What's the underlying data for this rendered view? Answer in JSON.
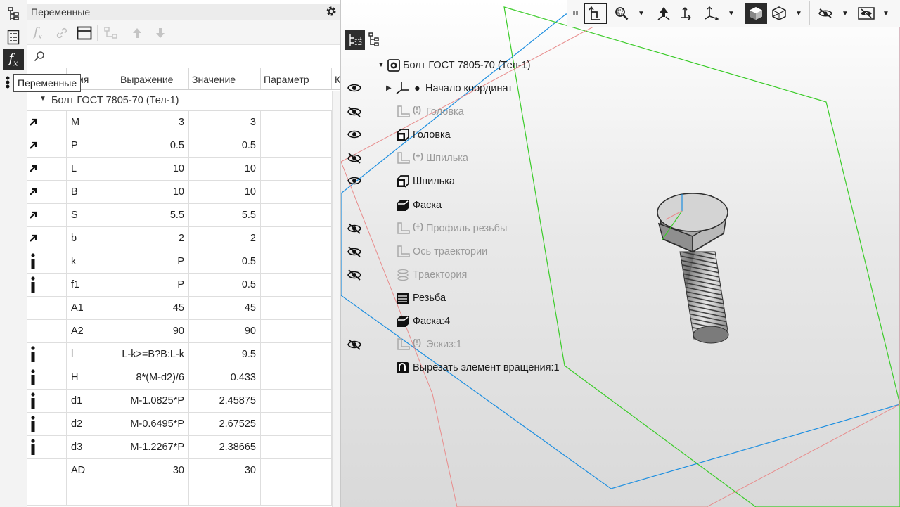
{
  "panel": {
    "title": "Переменные",
    "search_placeholder": "",
    "columns": [
      "Имя",
      "Выражение",
      "Значение",
      "Параметр",
      "К"
    ],
    "group_label": "Болт ГОСТ 7805-70 (Тел-1)",
    "rows": [
      {
        "icon": "arrow",
        "name": "M",
        "expr": "3",
        "value": "3"
      },
      {
        "icon": "arrow",
        "name": "P",
        "expr": "0.5",
        "value": "0.5"
      },
      {
        "icon": "arrow",
        "name": "L",
        "expr": "10",
        "value": "10"
      },
      {
        "icon": "arrow",
        "name": "B",
        "expr": "10",
        "value": "10"
      },
      {
        "icon": "arrow",
        "name": "S",
        "expr": "5.5",
        "value": "5.5"
      },
      {
        "icon": "arrow",
        "name": "b",
        "expr": "2",
        "value": "2"
      },
      {
        "icon": "info",
        "name": "k",
        "expr": "P",
        "value": "0.5"
      },
      {
        "icon": "info",
        "name": "f1",
        "expr": "P",
        "value": "0.5"
      },
      {
        "icon": "",
        "name": "A1",
        "expr": "45",
        "value": "45"
      },
      {
        "icon": "",
        "name": "A2",
        "expr": "90",
        "value": "90"
      },
      {
        "icon": "info",
        "name": "l",
        "expr": "L-k>=B?B:L-k",
        "value": "9.5"
      },
      {
        "icon": "info",
        "name": "H",
        "expr": "8*(M-d2)/6",
        "value": "0.433"
      },
      {
        "icon": "info",
        "name": "d1",
        "expr": "M-1.0825*P",
        "value": "2.45875"
      },
      {
        "icon": "info",
        "name": "d2",
        "expr": "M-0.6495*P",
        "value": "2.67525"
      },
      {
        "icon": "info",
        "name": "d3",
        "expr": "M-1.2267*P",
        "value": "2.38665"
      },
      {
        "icon": "",
        "name": "AD",
        "expr": "30",
        "value": "30"
      },
      {
        "icon": "",
        "name": "",
        "expr": "",
        "value": ""
      }
    ]
  },
  "tooltip": {
    "text": "Переменные"
  },
  "tree": {
    "root": "Болт ГОСТ 7805-70 (Тел-1)",
    "items": [
      {
        "label": "Начало координат",
        "prefix": "",
        "eye": "visible",
        "dim": false,
        "kind": "origin"
      },
      {
        "label": "Головка",
        "prefix": "(!)",
        "eye": "hidden",
        "dim": true,
        "kind": "sketch"
      },
      {
        "label": "Головка",
        "prefix": "",
        "eye": "visible",
        "dim": false,
        "kind": "extrude"
      },
      {
        "label": "Шпилька",
        "prefix": "(+)",
        "eye": "hidden",
        "dim": true,
        "kind": "sketch"
      },
      {
        "label": "Шпилька",
        "prefix": "",
        "eye": "visible",
        "dim": false,
        "kind": "extrude"
      },
      {
        "label": "Фаска",
        "prefix": "",
        "eye": "",
        "dim": false,
        "kind": "chamfer"
      },
      {
        "label": "Профиль резьбы",
        "prefix": "(+)",
        "eye": "hidden",
        "dim": true,
        "kind": "sketch"
      },
      {
        "label": "Ось траектории",
        "prefix": "",
        "eye": "hidden",
        "dim": true,
        "kind": "sketch"
      },
      {
        "label": "Траектория",
        "prefix": "",
        "eye": "hidden",
        "dim": true,
        "kind": "spiral"
      },
      {
        "label": "Резьба",
        "prefix": "",
        "eye": "",
        "dim": false,
        "kind": "thread"
      },
      {
        "label": "Фаска:4",
        "prefix": "",
        "eye": "",
        "dim": false,
        "kind": "chamfer"
      },
      {
        "label": "Эскиз:1",
        "prefix": "(!)",
        "eye": "hidden",
        "dim": true,
        "kind": "sketch"
      },
      {
        "label": "Вырезать элемент вращения:1",
        "prefix": "",
        "eye": "",
        "dim": false,
        "kind": "revolve-cut"
      }
    ]
  },
  "colors": {
    "axis_blue": "#1e8fe0",
    "axis_green": "#3ccc2a",
    "axis_red": "#e87a7a",
    "text_dim": "#9a9a9a"
  }
}
